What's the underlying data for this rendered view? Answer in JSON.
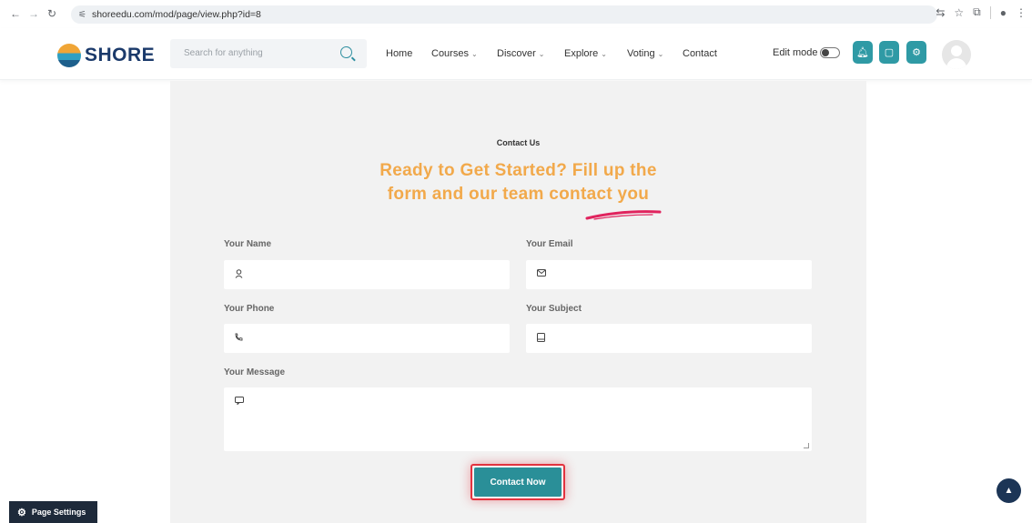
{
  "browser": {
    "url": "shoreedu.com/mod/page/view.php?id=8"
  },
  "header": {
    "logo_text": "SHORE",
    "search_placeholder": "Search for anything",
    "nav": [
      {
        "label": "Home",
        "has_chevron": false
      },
      {
        "label": "Courses",
        "has_chevron": true
      },
      {
        "label": "Discover",
        "has_chevron": true
      },
      {
        "label": "Explore",
        "has_chevron": true
      },
      {
        "label": "Voting",
        "has_chevron": true
      },
      {
        "label": "Contact",
        "has_chevron": false
      }
    ],
    "edit_mode_label": "Edit mode",
    "accent_color": "#2f9aa5"
  },
  "contact": {
    "eyebrow": "Contact Us",
    "headline_line1": "Ready to Get Started? Fill up the",
    "headline_line2": "form and our team contact you",
    "headline_color": "#f2a94b",
    "fields": {
      "name_label": "Your Name",
      "email_label": "Your Email",
      "phone_label": "Your Phone",
      "subject_label": "Your Subject",
      "message_label": "Your Message"
    },
    "submit_label": "Contact Now"
  },
  "footer": {
    "page_settings_label": "Page Settings"
  }
}
